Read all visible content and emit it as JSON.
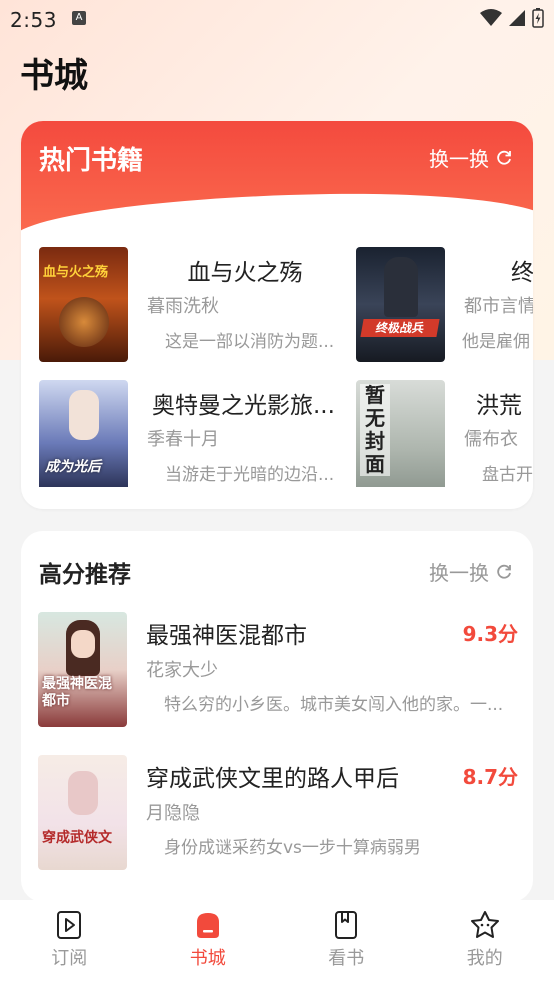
{
  "status": {
    "time": "2:53",
    "notif_icon": "A"
  },
  "page": {
    "title": "书城"
  },
  "hot": {
    "title": "热门书籍",
    "swap_label": "换一换",
    "books": [
      {
        "title": "血与火之殇",
        "author": "暮雨洗秋",
        "desc": "这是一部以消防为题...",
        "cover_text": "血与火之殇"
      },
      {
        "title": "终",
        "author": "都市言情",
        "desc": "他是雇佣",
        "cover_text": "终极战兵"
      },
      {
        "title": "奥特曼之光影旅...",
        "author": "季春十月",
        "desc": "当游走于光暗的边沿...",
        "cover_text": "成为光后"
      },
      {
        "title": "洪荒",
        "author": "儒布衣",
        "desc": "盘古开",
        "cover_text": "暂无封面"
      }
    ]
  },
  "rec": {
    "title": "高分推荐",
    "swap_label": "换一换",
    "books": [
      {
        "title": "最强神医混都市",
        "author": "花家大少",
        "desc": "特么穷的小乡医。城市美女闯入他的家。一...",
        "score": "9.3分",
        "cover_text": "最强神医混都市"
      },
      {
        "title": "穿成武侠文里的路人甲后",
        "author": "月隐隐",
        "desc": "身份成谜采药女vs一步十算病弱男",
        "score": "8.7分",
        "cover_text": "穿成武侠文"
      }
    ]
  },
  "tabs": [
    {
      "label": "订阅",
      "icon": "play-card-icon"
    },
    {
      "label": "书城",
      "icon": "store-icon"
    },
    {
      "label": "看书",
      "icon": "bookmark-book-icon"
    },
    {
      "label": "我的",
      "icon": "star-face-icon"
    }
  ],
  "colors": {
    "accent": "#f24a3c",
    "hot_header": "#f44a3e"
  }
}
